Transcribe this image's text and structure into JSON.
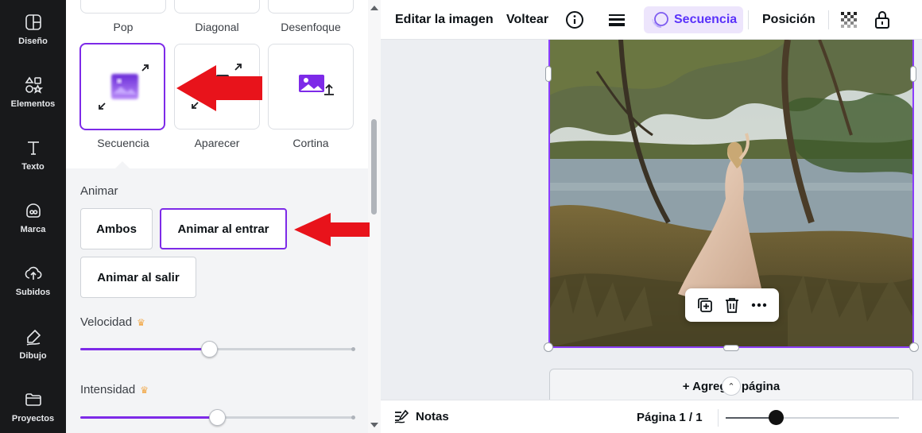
{
  "rail": {
    "items": [
      {
        "label": "Diseño",
        "icon": "layout-icon"
      },
      {
        "label": "Elementos",
        "icon": "shapes-icon"
      },
      {
        "label": "Texto",
        "icon": "text-icon"
      },
      {
        "label": "Marca",
        "icon": "brand-icon"
      },
      {
        "label": "Subidos",
        "icon": "cloud-upload-icon"
      },
      {
        "label": "Dibujo",
        "icon": "draw-icon"
      },
      {
        "label": "Proyectos",
        "icon": "folder-icon"
      }
    ]
  },
  "panel": {
    "top_row": [
      "Pop",
      "Diagonal",
      "Desenfoque"
    ],
    "cards": [
      {
        "label": "Secuencia",
        "selected": true
      },
      {
        "label": "Aparecer",
        "selected": false
      },
      {
        "label": "Cortina",
        "selected": false
      }
    ],
    "animate_label": "Animar",
    "animate_options": [
      {
        "label": "Ambos",
        "active": false
      },
      {
        "label": "Animar al entrar",
        "active": true
      },
      {
        "label": "Animar al salir",
        "active": false
      }
    ],
    "speed": {
      "label": "Velocidad",
      "value": 0.47
    },
    "intensity": {
      "label": "Intensidad",
      "value": 0.5
    }
  },
  "toolbar": {
    "edit_image": "Editar la imagen",
    "flip": "Voltear",
    "sequence": "Secuencia",
    "position": "Posición"
  },
  "canvas": {
    "add_page": "+ Agregar página"
  },
  "bottombar": {
    "notes": "Notas",
    "page_indicator": "Página 1 / 1",
    "zoom": 0.29
  },
  "colors": {
    "accent": "#7d2ae8",
    "rail_bg": "#18191b",
    "arrow": "#e8131b"
  }
}
